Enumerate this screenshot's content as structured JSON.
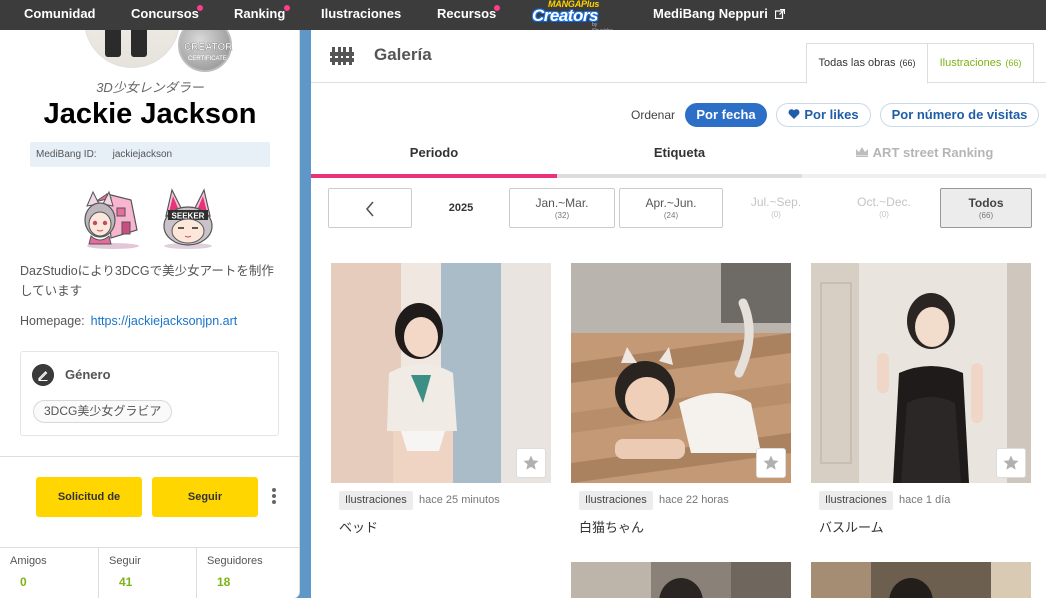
{
  "topnav": {
    "items": [
      {
        "label": "Comunidad",
        "dot": false
      },
      {
        "label": "Concursos",
        "dot": true
      },
      {
        "label": "Ranking",
        "dot": true
      },
      {
        "label": "Ilustraciones",
        "dot": false
      },
      {
        "label": "Recursos",
        "dot": true
      },
      {
        "label": "MediBang Neppuri",
        "dot": false
      }
    ],
    "logo": {
      "line1_a": "MANGA",
      "line1_b": "Plus",
      "line2": "Creators",
      "line3": "by Shueisha"
    },
    "dot_color": "#ff3d8b"
  },
  "profile": {
    "badge_text": "CREATOR",
    "badge_sub": "CERTIFICATE",
    "subtitle": "3D少女レンダラー",
    "name": "Jackie Jackson",
    "medibang_id_label": "MediBang ID:",
    "medibang_id": "jackiejackson",
    "mascot2_text": "SEEKER",
    "bio": "DazStudioにより3DCGで美少女アートを制作しています",
    "homepage_label": "Homepage:",
    "homepage_url": "https://jackiejacksonjpn.art",
    "genre_title": "Género",
    "genre_tag": "3DCG美少女グラビア",
    "request_button": "Solicitud de",
    "follow_button": "Seguir",
    "stats": [
      {
        "label": "Amigos",
        "value": "0"
      },
      {
        "label": "Seguir",
        "value": "41"
      },
      {
        "label": "Seguidores",
        "value": "18"
      }
    ]
  },
  "gallery": {
    "title": "Galería",
    "tab_all": {
      "label": "Todas las obras",
      "count": "(66)"
    },
    "tab_illustrations": {
      "label": "Ilustraciones",
      "count": "(66)"
    },
    "order_label": "Ordenar",
    "order_buttons": [
      "Por fecha",
      "Por likes",
      "Por número de visitas"
    ],
    "filter_tabs": [
      "Periodo",
      "Etiqueta",
      "ART street Ranking"
    ],
    "year": "2025",
    "quarters": [
      {
        "label": "Jan.~Mar.",
        "count": "(32)",
        "state": "normal"
      },
      {
        "label": "Apr.~Jun.",
        "count": "(24)",
        "state": "normal"
      },
      {
        "label": "Jul.~Sep.",
        "count": "(0)",
        "state": "disabled"
      },
      {
        "label": "Oct.~Dec.",
        "count": "(0)",
        "state": "disabled"
      },
      {
        "label": "Todos",
        "count": "(66)",
        "state": "selected"
      }
    ],
    "works": [
      {
        "category": "Ilustraciones",
        "time": "hace 25 minutos",
        "title": "ベッド"
      },
      {
        "category": "Ilustraciones",
        "time": "hace 22 horas",
        "title": "白猫ちゃん"
      },
      {
        "category": "Ilustraciones",
        "time": "hace 1 día",
        "title": "バスルーム"
      }
    ]
  },
  "colors": {
    "nav_bg": "#3c3c3c",
    "accent_pink": "#e8337a",
    "primary_blue": "#2d6ec7",
    "link_blue": "#1a73c9",
    "green": "#7cb316",
    "yellow": "#ffd600",
    "side_blue": "#5f97c8"
  }
}
